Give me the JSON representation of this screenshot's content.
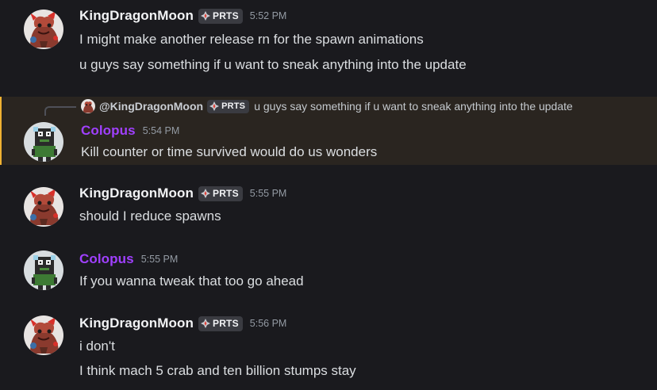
{
  "messages": [
    {
      "author": "KingDragonMoon",
      "tag": "PRTS",
      "time": "5:52 PM",
      "lines": [
        "I might make another release rn for the spawn animations",
        "u guys say something if u want to sneak anything into the update"
      ]
    },
    {
      "reply": {
        "mention": "@KingDragonMoon",
        "tag": "PRTS",
        "preview": "u guys say something if u want to sneak anything into the update"
      },
      "author": "Colopus",
      "time": "5:54 PM",
      "lines": [
        "Kill counter or time survived would do us wonders"
      ]
    },
    {
      "author": "KingDragonMoon",
      "tag": "PRTS",
      "time": "5:55 PM",
      "lines": [
        "should I reduce spawns"
      ]
    },
    {
      "author": "Colopus",
      "time": "5:55 PM",
      "lines": [
        "If you wanna tweak that too go ahead"
      ]
    },
    {
      "author": "KingDragonMoon",
      "tag": "PRTS",
      "time": "5:56 PM",
      "lines": [
        "i don't",
        "I think mach 5 crab and ten billion stumps stay"
      ]
    }
  ],
  "colors": {
    "background": "#1a1a1e",
    "highlight_bg": "#2a2520",
    "highlight_border": "#f0b232",
    "colopus_name": "#a040ff",
    "tag_bg": "#3a3b41"
  },
  "icons": {
    "avatar_kdm": "dragon-avatar",
    "avatar_colopus": "pixel-creature-avatar",
    "tag_icon": "diamond-emblem-icon"
  }
}
